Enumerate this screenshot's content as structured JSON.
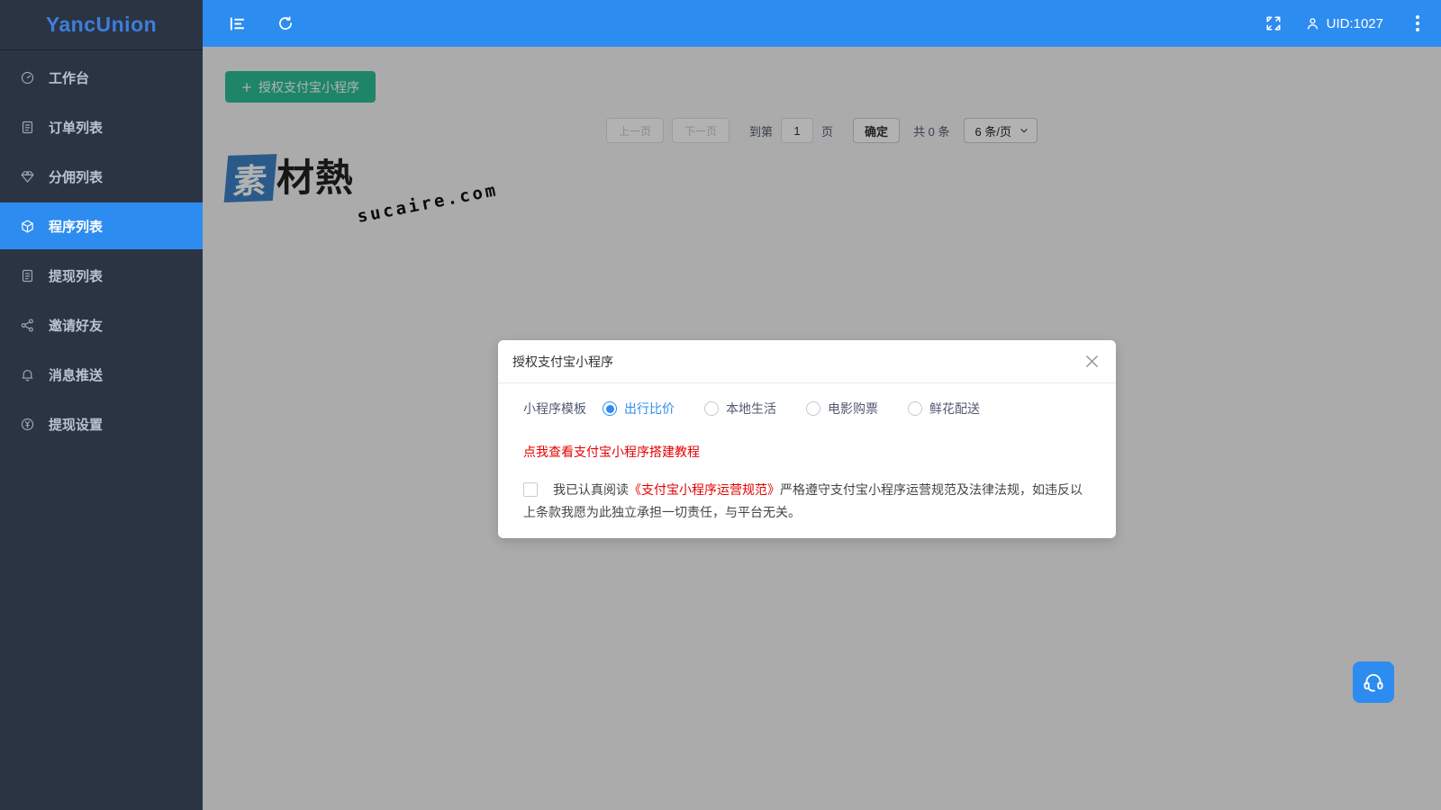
{
  "sidebar": {
    "logo": "YancUnion",
    "items": [
      {
        "label": "工作台",
        "icon": "dashboard-icon"
      },
      {
        "label": "订单列表",
        "icon": "order-list-icon"
      },
      {
        "label": "分佣列表",
        "icon": "commission-gem-icon"
      },
      {
        "label": "程序列表",
        "icon": "program-cube-icon",
        "active": true
      },
      {
        "label": "提现列表",
        "icon": "withdraw-list-icon"
      },
      {
        "label": "邀请好友",
        "icon": "invite-share-icon"
      },
      {
        "label": "消息推送",
        "icon": "message-bell-icon"
      },
      {
        "label": "提现设置",
        "icon": "withdraw-settings-yen-icon"
      }
    ]
  },
  "topbar": {
    "uid_label": "UID:1027"
  },
  "main": {
    "authorize_button_label": "授权支付宝小程序",
    "pagination": {
      "prev_label": "上一页",
      "next_label": "下一页",
      "goto_prefix": "到第",
      "page_input_value": "1",
      "goto_suffix": "页",
      "confirm_label": "确定",
      "total_label": "共 0 条",
      "page_size_label": "6 条/页"
    },
    "watermark": {
      "logo_first_char": "素",
      "logo_rest": "材熱",
      "domain_text": "sucaire.com"
    }
  },
  "modal": {
    "title": "授权支付宝小程序",
    "template_label": "小程序模板",
    "options": [
      {
        "label": "出行比价",
        "selected": true
      },
      {
        "label": "本地生活",
        "selected": false
      },
      {
        "label": "电影购票",
        "selected": false
      },
      {
        "label": "鲜花配送",
        "selected": false
      }
    ],
    "selected_option": "出行比价",
    "tutorial_link_label": "点我查看支付宝小程序搭建教程",
    "agreement_prefix": "我已认真阅读",
    "agreement_link": "《支付宝小程序运营规范》",
    "agreement_suffix": "严格遵守支付宝小程序运营规范及法律法规，如违反以上条款我愿为此独立承担一切责任，与平台无关。"
  },
  "colors": {
    "primary_blue": "#2d8cf0",
    "sidebar_bg": "#2b3442",
    "button_green": "#2bbf95",
    "link_red": "#e60000",
    "overlay": "rgba(0,0,0,0.3)"
  }
}
